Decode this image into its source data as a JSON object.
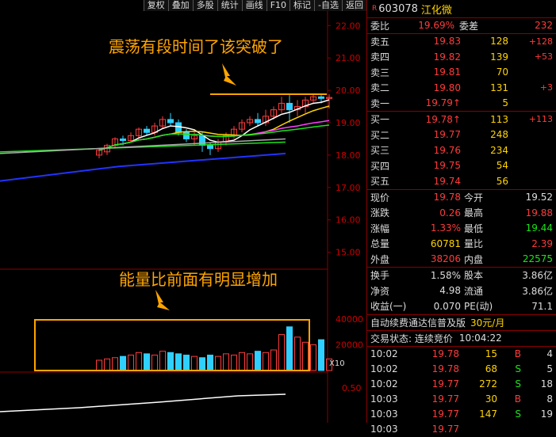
{
  "toolbar": [
    "复权",
    "叠加",
    "多股",
    "统计",
    "画线",
    "F10",
    "标记",
    "-自选",
    "返回"
  ],
  "stock": {
    "code": "603078",
    "name": "江化微",
    "badge": "R"
  },
  "annotation_top": "震荡有段时间了该突破了",
  "annotation_mid": "能量比前面有明显增加",
  "x_marker": "X10",
  "price_ticks": [
    "22.00",
    "21.00",
    "20.00",
    "19.00",
    "18.00",
    "17.00",
    "16.00",
    "15.00"
  ],
  "vol_ticks": [
    "40000",
    "20000"
  ],
  "ind_ticks": [
    "0.50"
  ],
  "weibi": {
    "label": "委比",
    "value": "19.69%",
    "label2": "委差",
    "value2": "232"
  },
  "asks": [
    {
      "label": "卖五",
      "price": "19.83",
      "vol": "128",
      "chg": "+128"
    },
    {
      "label": "卖四",
      "price": "19.82",
      "vol": "139",
      "chg": "+53"
    },
    {
      "label": "卖三",
      "price": "19.81",
      "vol": "70",
      "chg": ""
    },
    {
      "label": "卖二",
      "price": "19.80",
      "vol": "131",
      "chg": "+3"
    },
    {
      "label": "卖一",
      "price": "19.79↑",
      "vol": "5",
      "chg": ""
    }
  ],
  "bids": [
    {
      "label": "买一",
      "price": "19.78↑",
      "vol": "113",
      "chg": "+113"
    },
    {
      "label": "买二",
      "price": "19.77",
      "vol": "248",
      "chg": ""
    },
    {
      "label": "买三",
      "price": "19.76",
      "vol": "234",
      "chg": ""
    },
    {
      "label": "买四",
      "price": "19.75",
      "vol": "54",
      "chg": ""
    },
    {
      "label": "买五",
      "price": "19.74",
      "vol": "56",
      "chg": ""
    }
  ],
  "quote": [
    {
      "l1": "现价",
      "v1": "19.78",
      "c1": "r",
      "l2": "今开",
      "v2": "19.52",
      "c2": "w"
    },
    {
      "l1": "涨跌",
      "v1": "0.26",
      "c1": "r",
      "l2": "最高",
      "v2": "19.88",
      "c2": "r"
    },
    {
      "l1": "涨幅",
      "v1": "1.33%",
      "c1": "r",
      "l2": "最低",
      "v2": "19.44",
      "c2": "g"
    },
    {
      "l1": "总量",
      "v1": "60781",
      "c1": "y",
      "l2": "量比",
      "v2": "2.39",
      "c2": "r"
    },
    {
      "l1": "外盘",
      "v1": "38206",
      "c1": "r",
      "l2": "内盘",
      "v2": "22575",
      "c2": "g"
    }
  ],
  "stats": [
    {
      "l1": "换手",
      "v1": "1.58%",
      "l2": "股本",
      "v2": "3.86亿"
    },
    {
      "l1": "净资",
      "v1": "4.98",
      "l2": "流通",
      "v2": "3.86亿"
    },
    {
      "l1": "收益(一)",
      "v1": "0.070",
      "l2": "PE(动)",
      "v2": "71.1"
    }
  ],
  "promo": {
    "text": "自动续费通达信普及版",
    "price": "30元/月"
  },
  "trade_status": {
    "text": "交易状态: 连续竞价",
    "time": "10:04:22"
  },
  "ticks": [
    {
      "t": "10:02",
      "p": "19.78",
      "v": "15",
      "s": "B",
      "n": "4"
    },
    {
      "t": "10:02",
      "p": "19.78",
      "v": "68",
      "s": "S",
      "n": "5"
    },
    {
      "t": "10:02",
      "p": "19.77",
      "v": "272",
      "s": "S",
      "n": "18"
    },
    {
      "t": "10:03",
      "p": "19.77",
      "v": "30",
      "s": "B",
      "n": "8"
    },
    {
      "t": "10:03",
      "p": "19.77",
      "v": "147",
      "s": "S",
      "n": "19"
    },
    {
      "t": "10:03",
      "p": "19.77",
      "v": "",
      "s": "",
      "n": ""
    }
  ],
  "chart_data": {
    "type": "candlestick",
    "price_range": [
      14.6,
      22.3
    ],
    "volume_range": [
      0,
      45000
    ],
    "candles": [
      [
        18.0,
        18.15,
        17.9,
        18.2
      ],
      [
        18.1,
        18.3,
        18.0,
        18.35
      ],
      [
        18.3,
        18.5,
        18.2,
        18.55
      ],
      [
        18.5,
        18.45,
        18.3,
        18.6
      ],
      [
        18.45,
        18.6,
        18.4,
        18.7
      ],
      [
        18.6,
        18.8,
        18.5,
        18.85
      ],
      [
        18.8,
        18.7,
        18.6,
        18.9
      ],
      [
        18.7,
        18.9,
        18.6,
        19.0
      ],
      [
        18.9,
        19.1,
        18.8,
        19.2
      ],
      [
        19.1,
        19.0,
        18.9,
        19.3
      ],
      [
        19.0,
        18.7,
        18.6,
        19.1
      ],
      [
        18.7,
        18.5,
        18.4,
        18.8
      ],
      [
        18.5,
        18.6,
        18.3,
        18.7
      ],
      [
        18.6,
        18.3,
        18.1,
        18.7
      ],
      [
        18.3,
        18.2,
        18.0,
        18.4
      ],
      [
        18.2,
        18.4,
        18.1,
        18.5
      ],
      [
        18.4,
        18.6,
        18.3,
        18.7
      ],
      [
        18.6,
        18.8,
        18.5,
        18.9
      ],
      [
        18.8,
        19.0,
        18.7,
        19.1
      ],
      [
        19.0,
        19.1,
        18.9,
        19.2
      ],
      [
        19.1,
        19.0,
        18.9,
        19.3
      ],
      [
        19.0,
        19.2,
        18.9,
        19.4
      ],
      [
        19.2,
        19.4,
        19.1,
        19.5
      ],
      [
        19.4,
        19.6,
        19.3,
        19.8
      ],
      [
        19.6,
        19.4,
        19.0,
        19.85
      ],
      [
        19.4,
        19.5,
        19.2,
        19.7
      ],
      [
        19.5,
        19.7,
        19.3,
        19.8
      ],
      [
        19.7,
        19.8,
        19.6,
        19.9
      ],
      [
        19.8,
        19.75,
        19.6,
        19.85
      ],
      [
        19.75,
        19.78,
        19.44,
        19.88
      ]
    ],
    "volumes": [
      8000,
      9000,
      10000,
      11000,
      12000,
      14000,
      13000,
      12000,
      15000,
      14000,
      13000,
      12000,
      11000,
      10000,
      12000,
      11000,
      13000,
      12000,
      14000,
      13000,
      15000,
      14000,
      16000,
      28000,
      34000,
      26000,
      22000,
      20000,
      24000,
      9000
    ]
  }
}
